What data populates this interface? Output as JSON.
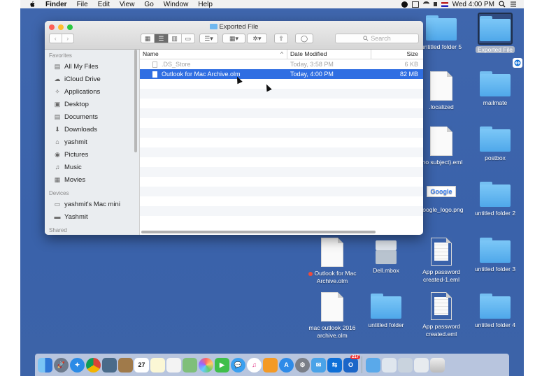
{
  "menubar": {
    "app": "Finder",
    "items": [
      "File",
      "Edit",
      "View",
      "Go",
      "Window",
      "Help"
    ],
    "clock": "Wed 4:00 PM"
  },
  "window": {
    "title": "Exported File",
    "search_placeholder": "Search",
    "sidebar": {
      "favorites_header": "Favorites",
      "favorites": [
        {
          "label": "All My Files",
          "icon": "all-files-icon"
        },
        {
          "label": "iCloud Drive",
          "icon": "cloud-icon"
        },
        {
          "label": "Applications",
          "icon": "applications-icon"
        },
        {
          "label": "Desktop",
          "icon": "desktop-icon"
        },
        {
          "label": "Documents",
          "icon": "documents-icon"
        },
        {
          "label": "Downloads",
          "icon": "downloads-icon"
        },
        {
          "label": "yashmit",
          "icon": "home-icon"
        },
        {
          "label": "Pictures",
          "icon": "pictures-icon"
        },
        {
          "label": "Music",
          "icon": "music-icon"
        },
        {
          "label": "Movies",
          "icon": "movies-icon"
        }
      ],
      "devices_header": "Devices",
      "devices": [
        {
          "label": "yashmit's Mac mini",
          "icon": "computer-icon"
        },
        {
          "label": "Yashmit",
          "icon": "disk-icon"
        }
      ],
      "shared_header": "Shared"
    },
    "columns": {
      "name": "Name",
      "date": "Date Modified",
      "size": "Size"
    },
    "files": [
      {
        "name": ".DS_Store",
        "date": "Today, 3:58 PM",
        "size": "6 KB",
        "state": "dim"
      },
      {
        "name": "Outlook for Mac Archive.olm",
        "date": "Today, 4:00 PM",
        "size": "82 MB",
        "state": "selected"
      }
    ]
  },
  "desktop": {
    "icons": [
      {
        "label": "untitled folder 5",
        "type": "folder"
      },
      {
        "label": "Exported File",
        "type": "folder",
        "selected": true
      },
      {
        "label": ".localized",
        "type": "doc"
      },
      {
        "label": "mailmate",
        "type": "folder"
      },
      {
        "label": "(no subject).eml",
        "type": "doc"
      },
      {
        "label": "postbox",
        "type": "folder"
      },
      {
        "label": "google_logo.png",
        "type": "image"
      },
      {
        "label": "untitled folder 2",
        "type": "folder"
      },
      {
        "label": "Outlook for Mac Archive.olm",
        "type": "doc"
      },
      {
        "label": "Dell.mbox",
        "type": "mbox"
      },
      {
        "label": "App password created-1.eml",
        "type": "doc"
      },
      {
        "label": "untitled folder 3",
        "type": "folder"
      },
      {
        "label": "mac outlook 2016 archive.olm",
        "type": "doc"
      },
      {
        "label": "untitled folder",
        "type": "folder"
      },
      {
        "label": "App password created.eml",
        "type": "doc"
      },
      {
        "label": "untitled folder 4",
        "type": "folder"
      }
    ],
    "google_image_text": "Google",
    "colors": {
      "desktop": "#3c63a8",
      "folder": "#5fb3ee",
      "selection": "#2f6ee2"
    }
  },
  "dock": {
    "apps": [
      "Finder",
      "Launchpad",
      "Safari",
      "Chrome",
      "Preview",
      "Notefile",
      "Calendar",
      "Notes",
      "Reminders",
      "Maps",
      "Photos",
      "FaceTime",
      "Messages",
      "iTunes",
      "iBooks",
      "App Store",
      "System Preferences",
      "Mail",
      "TeamViewer",
      "Outlook"
    ],
    "calendar_day": "27",
    "outlook_badge": "217"
  }
}
